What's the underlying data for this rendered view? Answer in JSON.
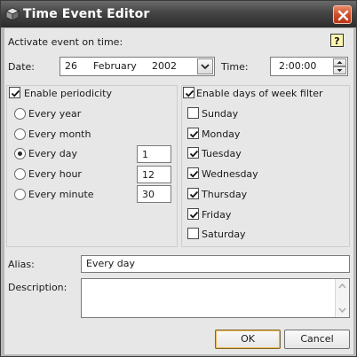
{
  "window": {
    "title": "Time Event Editor",
    "app_icon": "cube-icon",
    "close_icon": "close-icon"
  },
  "colors": {
    "titlebar": "#3c3c3c",
    "close_button": "#d2522b",
    "dialog_background": "#e7e7e7",
    "default_button_border": "#f3b64d"
  },
  "activate": {
    "label": "Activate event on time:",
    "help_icon": "help-icon"
  },
  "date": {
    "label": "Date:",
    "day": "26",
    "month": "February",
    "year": "2002"
  },
  "time": {
    "label": "Time:",
    "value": "2:00:00"
  },
  "periodicity": {
    "label": "Enable periodicity",
    "checked": true,
    "options": [
      {
        "label": "Every year",
        "selected": false,
        "value": ""
      },
      {
        "label": "Every month",
        "selected": false,
        "value": ""
      },
      {
        "label": "Every day",
        "selected": true,
        "value": "1"
      },
      {
        "label": "Every hour",
        "selected": false,
        "value": "12"
      },
      {
        "label": "Every minute",
        "selected": false,
        "value": "30"
      }
    ]
  },
  "days_filter": {
    "label": "Enable days of week filter",
    "checked": true,
    "days": [
      {
        "label": "Sunday",
        "checked": false
      },
      {
        "label": "Monday",
        "checked": true
      },
      {
        "label": "Tuesday",
        "checked": true
      },
      {
        "label": "Wednesday",
        "checked": true
      },
      {
        "label": "Thursday",
        "checked": true
      },
      {
        "label": "Friday",
        "checked": true
      },
      {
        "label": "Saturday",
        "checked": false
      }
    ]
  },
  "alias": {
    "label": "Alias:",
    "value": "Every day"
  },
  "description": {
    "label": "Description:",
    "value": ""
  },
  "buttons": {
    "ok": "OK",
    "cancel": "Cancel"
  }
}
